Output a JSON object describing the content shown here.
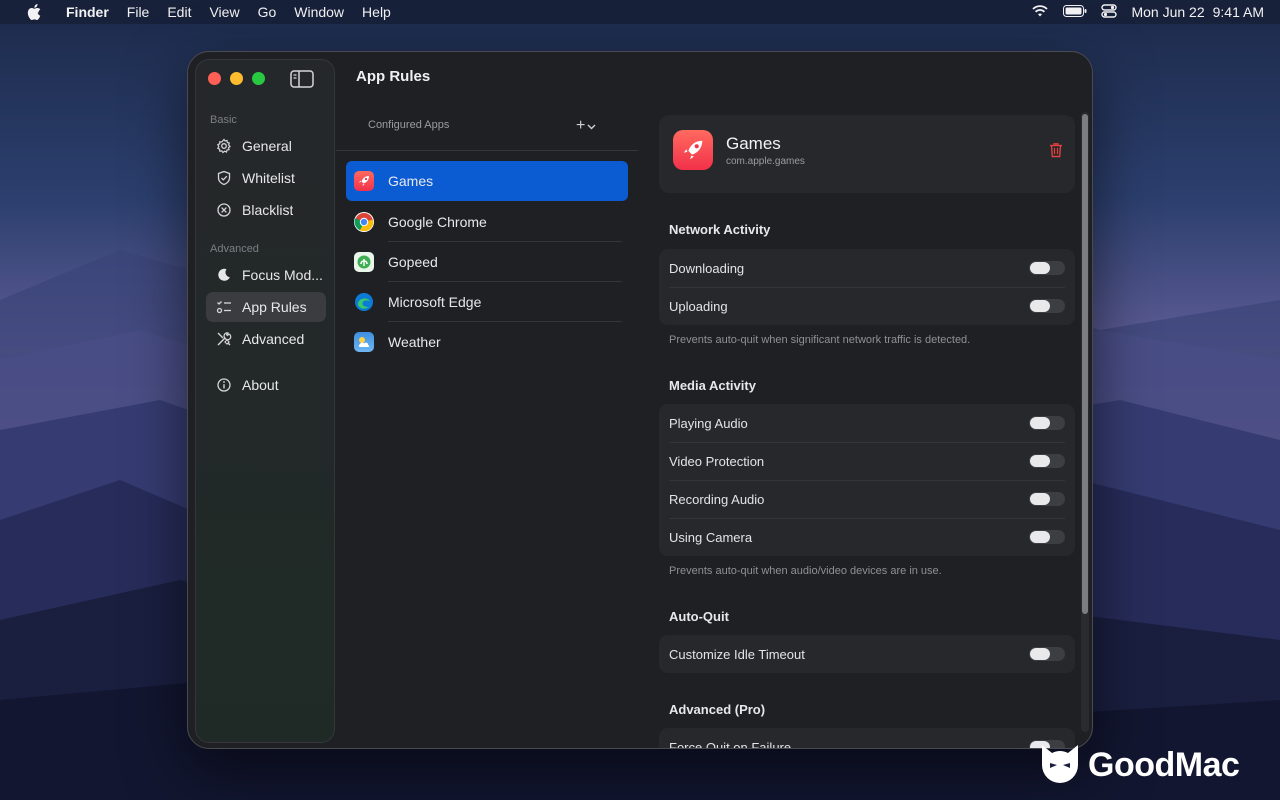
{
  "menubar": {
    "app_name": "Finder",
    "items": [
      "File",
      "Edit",
      "View",
      "Go",
      "Window",
      "Help"
    ],
    "date": "Mon Jun 22",
    "time": "9:41 AM"
  },
  "window": {
    "title": "App Rules",
    "sidebar": {
      "basic_label": "Basic",
      "advanced_label": "Advanced",
      "items": [
        {
          "label": "General",
          "icon": "gear-icon"
        },
        {
          "label": "Whitelist",
          "icon": "shield-check-icon"
        },
        {
          "label": "Blacklist",
          "icon": "circle-x-icon"
        },
        {
          "label": "Focus Mod...",
          "icon": "moon-icon"
        },
        {
          "label": "App Rules",
          "icon": "list-checks-icon"
        },
        {
          "label": "Advanced",
          "icon": "tools-icon"
        },
        {
          "label": "About",
          "icon": "info-icon"
        }
      ],
      "active": "App Rules"
    },
    "apps_list": {
      "header": "Configured Apps",
      "add_label": "+",
      "apps": [
        {
          "name": "Games",
          "icon": "rocket-icon",
          "selected": true
        },
        {
          "name": "Google Chrome",
          "icon": "chrome-icon"
        },
        {
          "name": "Gopeed",
          "icon": "gopeed-icon"
        },
        {
          "name": "Microsoft Edge",
          "icon": "edge-icon"
        },
        {
          "name": "Weather",
          "icon": "weather-icon"
        }
      ]
    },
    "detail": {
      "app_name": "Games",
      "bundle_id": "com.apple.games",
      "sections": [
        {
          "title": "Network Activity",
          "rows": [
            {
              "label": "Downloading",
              "on": false
            },
            {
              "label": "Uploading",
              "on": false
            }
          ],
          "note": "Prevents auto-quit when significant network traffic is detected."
        },
        {
          "title": "Media Activity",
          "rows": [
            {
              "label": "Playing Audio",
              "on": false
            },
            {
              "label": "Video Protection",
              "on": false
            },
            {
              "label": "Recording Audio",
              "on": false
            },
            {
              "label": "Using Camera",
              "on": false
            }
          ],
          "note": "Prevents auto-quit when audio/video devices are in use."
        },
        {
          "title": "Auto-Quit",
          "rows": [
            {
              "label": "Customize Idle Timeout",
              "on": false
            }
          ]
        },
        {
          "title": "Advanced (Pro)",
          "rows": [
            {
              "label": "Force Quit on Failure",
              "on": false
            }
          ]
        }
      ]
    }
  },
  "watermark": {
    "text": "GoodMac"
  },
  "colors": {
    "accent": "#0b5bd3",
    "window_bg": "#1f2023",
    "danger": "#e0413c"
  }
}
